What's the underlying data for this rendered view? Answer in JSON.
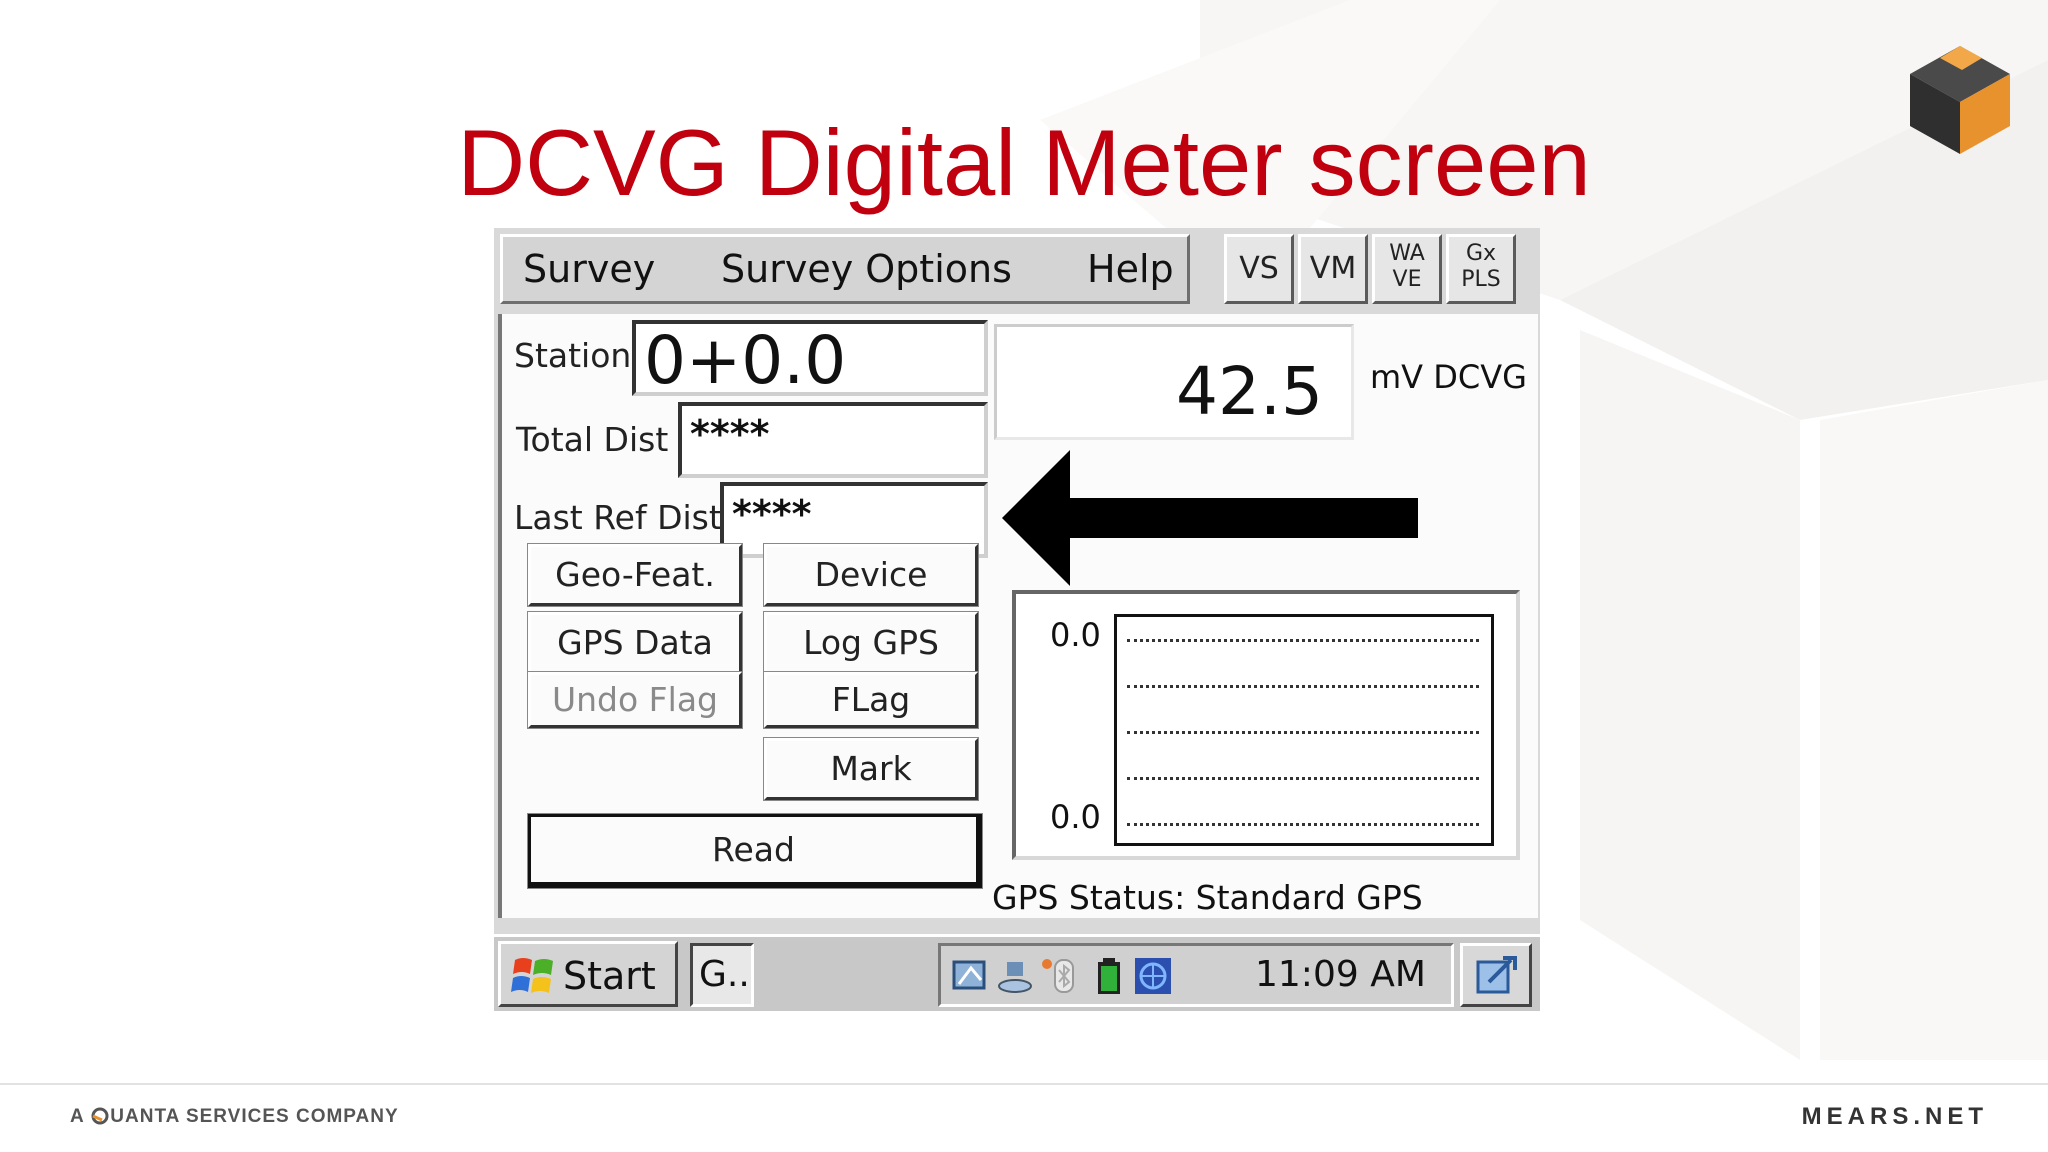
{
  "slide": {
    "title": "DCVG Digital Meter screen",
    "footer_left_prefix": "A ",
    "footer_left_company": "UANTA SERVICES COMPANY",
    "footer_right": "MEARS.NET"
  },
  "menubar": {
    "survey_label": "Survey",
    "survey_options_label": "Survey Options",
    "help_label": "Help"
  },
  "modes": {
    "vs": "VS",
    "vm": "VM",
    "wave_top": "WA",
    "wave_bottom": "VE",
    "gxpls_top": "Gx",
    "gxpls_bottom": "PLS"
  },
  "fields": {
    "station_label": "Station",
    "station_value": "0+0.0",
    "total_dist_label": "Total Dist",
    "total_dist_value": "****",
    "last_ref_dist_label": "Last Ref Dist",
    "last_ref_dist_value": "****"
  },
  "reading": {
    "value": "42.5",
    "unit": "mV DCVG"
  },
  "buttons": {
    "geo_feat": "Geo-Feat.",
    "device": "Device",
    "gps_data": "GPS Data",
    "log_gps": "Log GPS",
    "undo_flag": "Undo Flag",
    "flag": "FLag",
    "mark": "Mark",
    "read": "Read"
  },
  "graph": {
    "top_value": "0.0",
    "bottom_value": "0.0"
  },
  "gps_status": "GPS Status: Standard GPS",
  "taskbar": {
    "start_label": "Start",
    "task_label": "G..",
    "clock": "11:09 AM"
  },
  "colors": {
    "title_red": "#c0000e",
    "cube_orange": "#e8922e"
  }
}
